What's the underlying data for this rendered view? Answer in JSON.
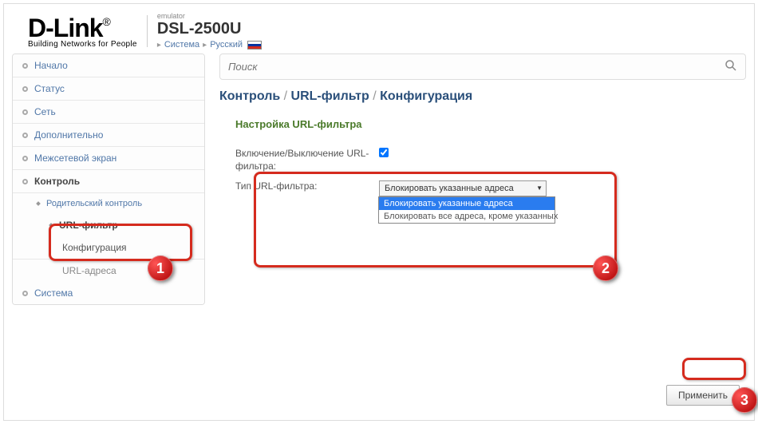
{
  "header": {
    "brand_main": "D-Link",
    "brand_reg": "®",
    "brand_tagline": "Building Networks for People",
    "emulator": "emulator",
    "model": "DSL-2500U",
    "bc_system": "Система",
    "bc_language": "Русский"
  },
  "sidebar": {
    "items": {
      "home": "Начало",
      "status": "Статус",
      "network": "Сеть",
      "additional": "Дополнительно",
      "firewall": "Межсетевой экран",
      "control": "Контроль",
      "parental": "Родительский контроль",
      "urlfilter": "URL-фильтр",
      "configuration": "Конфигурация",
      "urladdresses": "URL-адреса",
      "system": "Система"
    }
  },
  "search": {
    "placeholder": "Поиск"
  },
  "breadcrumb": {
    "a": "Контроль",
    "b": "URL-фильтр",
    "c": "Конфигурация"
  },
  "section": {
    "title": "Настройка URL-фильтра"
  },
  "form": {
    "enable_label": "Включение/Выключение URL-фильтра:",
    "enable_checked": true,
    "type_label": "Тип URL-фильтра:",
    "select_value": "Блокировать указанные адреса",
    "options": {
      "opt1": "Блокировать указанные адреса",
      "opt2": "Блокировать все адреса, кроме указанных"
    }
  },
  "apply": {
    "label": "Применить"
  },
  "badges": {
    "b1": "1",
    "b2": "2",
    "b3": "3"
  }
}
